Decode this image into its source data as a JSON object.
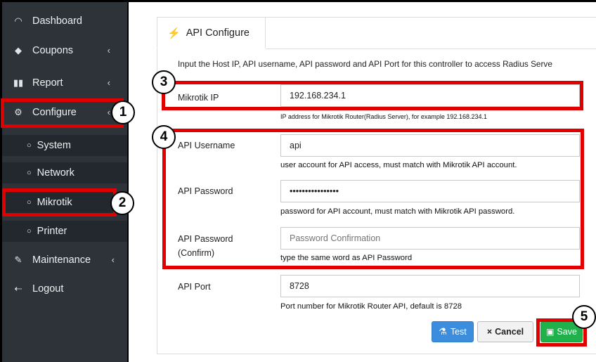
{
  "sidebar": {
    "items": [
      {
        "label": "Dashboard",
        "icon": "gauge-icon"
      },
      {
        "label": "Coupons",
        "icon": "tag-icon",
        "chevron": "‹"
      },
      {
        "label": "Report",
        "icon": "bar-chart-icon",
        "chevron": "‹"
      },
      {
        "label": "Configure",
        "icon": "gear-icon",
        "chevron": "‹"
      },
      {
        "label": "Maintenance",
        "icon": "wrench-icon",
        "chevron": "‹"
      },
      {
        "label": "Logout",
        "icon": "logout-icon"
      }
    ],
    "configure_sub": [
      {
        "label": "System"
      },
      {
        "label": "Network"
      },
      {
        "label": "Mikrotik"
      },
      {
        "label": "Printer"
      }
    ]
  },
  "tab": {
    "label": "API Configure",
    "icon": "plug-icon"
  },
  "intro": "Input the Host IP, API username, API password and API Port for this controller to access Radius Serve",
  "fields": {
    "mikrotik_ip": {
      "label": "Mikrotik IP",
      "value": "192.168.234.1",
      "hint": "IP address for Mikrotik Router(Radius Server), for example 192.168.234.1"
    },
    "api_username": {
      "label": "API Username",
      "value": "api",
      "hint": "user account for API access, must match with Mikrotik API account."
    },
    "api_password": {
      "label": "API Password",
      "value": "••••••••••••••••",
      "hint": "password for API account, must match with Mikrotik API password."
    },
    "api_password_confirm": {
      "label_line1": "API Password",
      "label_line2": "(Confirm)",
      "placeholder": "Password Confirmation",
      "hint": "type the same word as API Password"
    },
    "api_port": {
      "label": "API Port",
      "value": "8728",
      "hint": "Port number for Mikrotik Router API, default is 8728"
    }
  },
  "buttons": {
    "test": "Test",
    "cancel": "Cancel",
    "save": "Save"
  },
  "badges": [
    "1",
    "2",
    "3",
    "4",
    "5"
  ],
  "colors": {
    "highlight": "#e00000",
    "sidebar_bg": "#2d3339",
    "test": "#3c8dde",
    "save": "#21b14c"
  }
}
